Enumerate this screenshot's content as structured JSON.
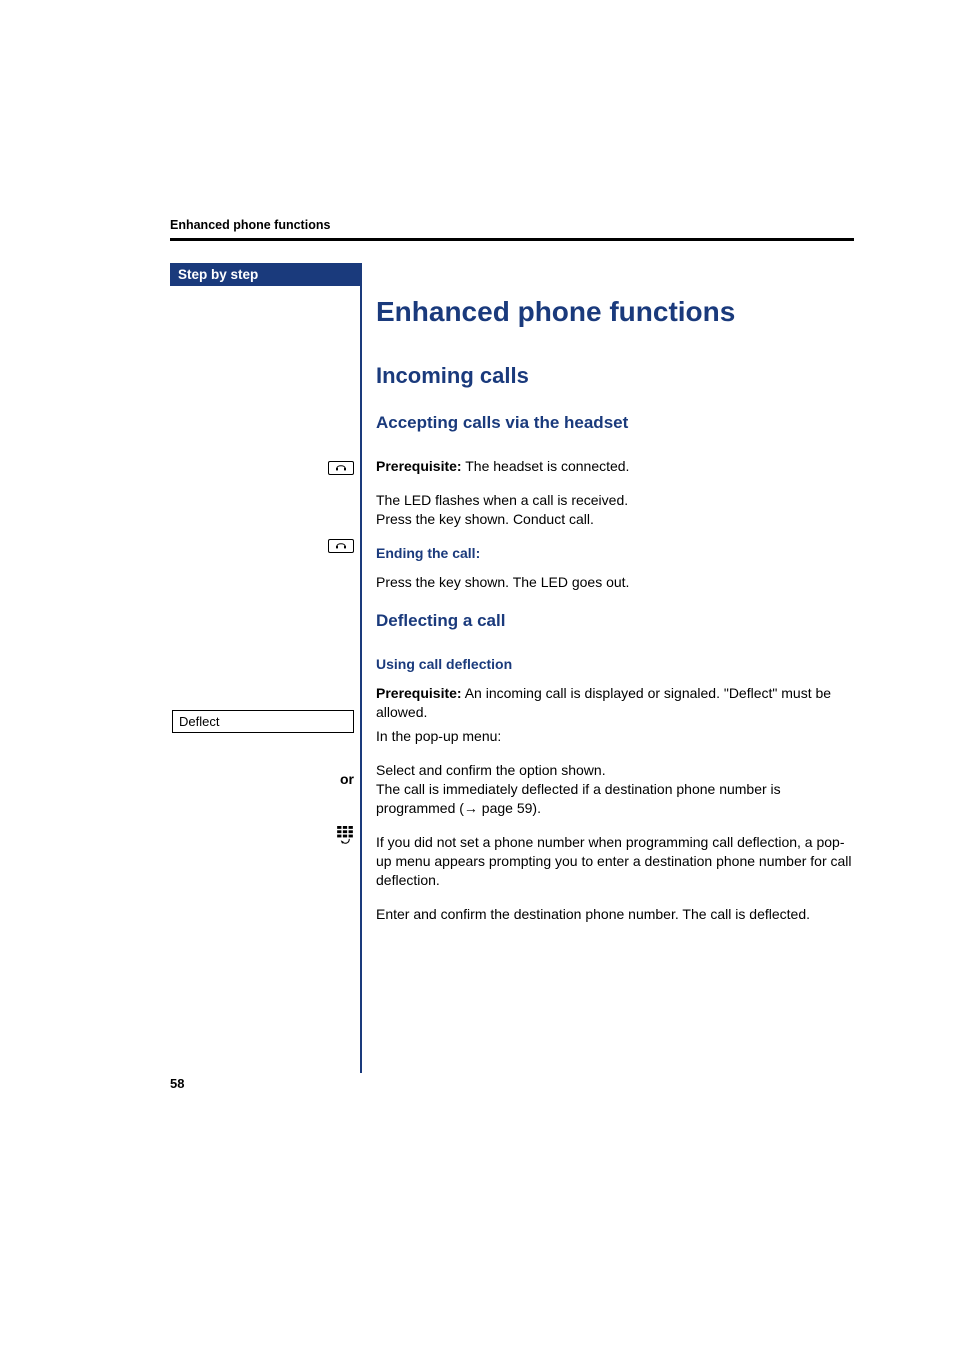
{
  "running_header": "Enhanced phone functions",
  "sidebar": {
    "title": "Step by step"
  },
  "headings": {
    "h1": "Enhanced phone functions",
    "h2": "Incoming calls",
    "h3a": "Accepting calls via the headset",
    "h4a": "Ending the call:",
    "h3b": "Deflecting a call",
    "h4b": "Using call deflection"
  },
  "body": {
    "prereq_label": "Prerequisite:",
    "prereq1_text": " The headset is connected.",
    "led_flashes": "The LED flashes when a call is received.\nPress the key shown. Conduct call.",
    "press_key_led_out": "Press the key shown. The LED goes out.",
    "prereq2_text": " An incoming call is displayed or signaled. \"Deflect\" must be allowed.",
    "popup_line": "In the pop-up menu:",
    "select_confirm": "Select and confirm the option shown.\nThe call is immediately deflected if a destination phone number is programmed (→ page 59).",
    "or_label": "or",
    "if_not_set": "If you did not set a phone number when programming call deflection, a pop-up menu appears prompting you to enter a destination phone number for call deflection.",
    "enter_confirm": "Enter and confirm the destination phone number. The call is deflected."
  },
  "steps": {
    "deflect_option": "Deflect"
  },
  "page_number": "58"
}
